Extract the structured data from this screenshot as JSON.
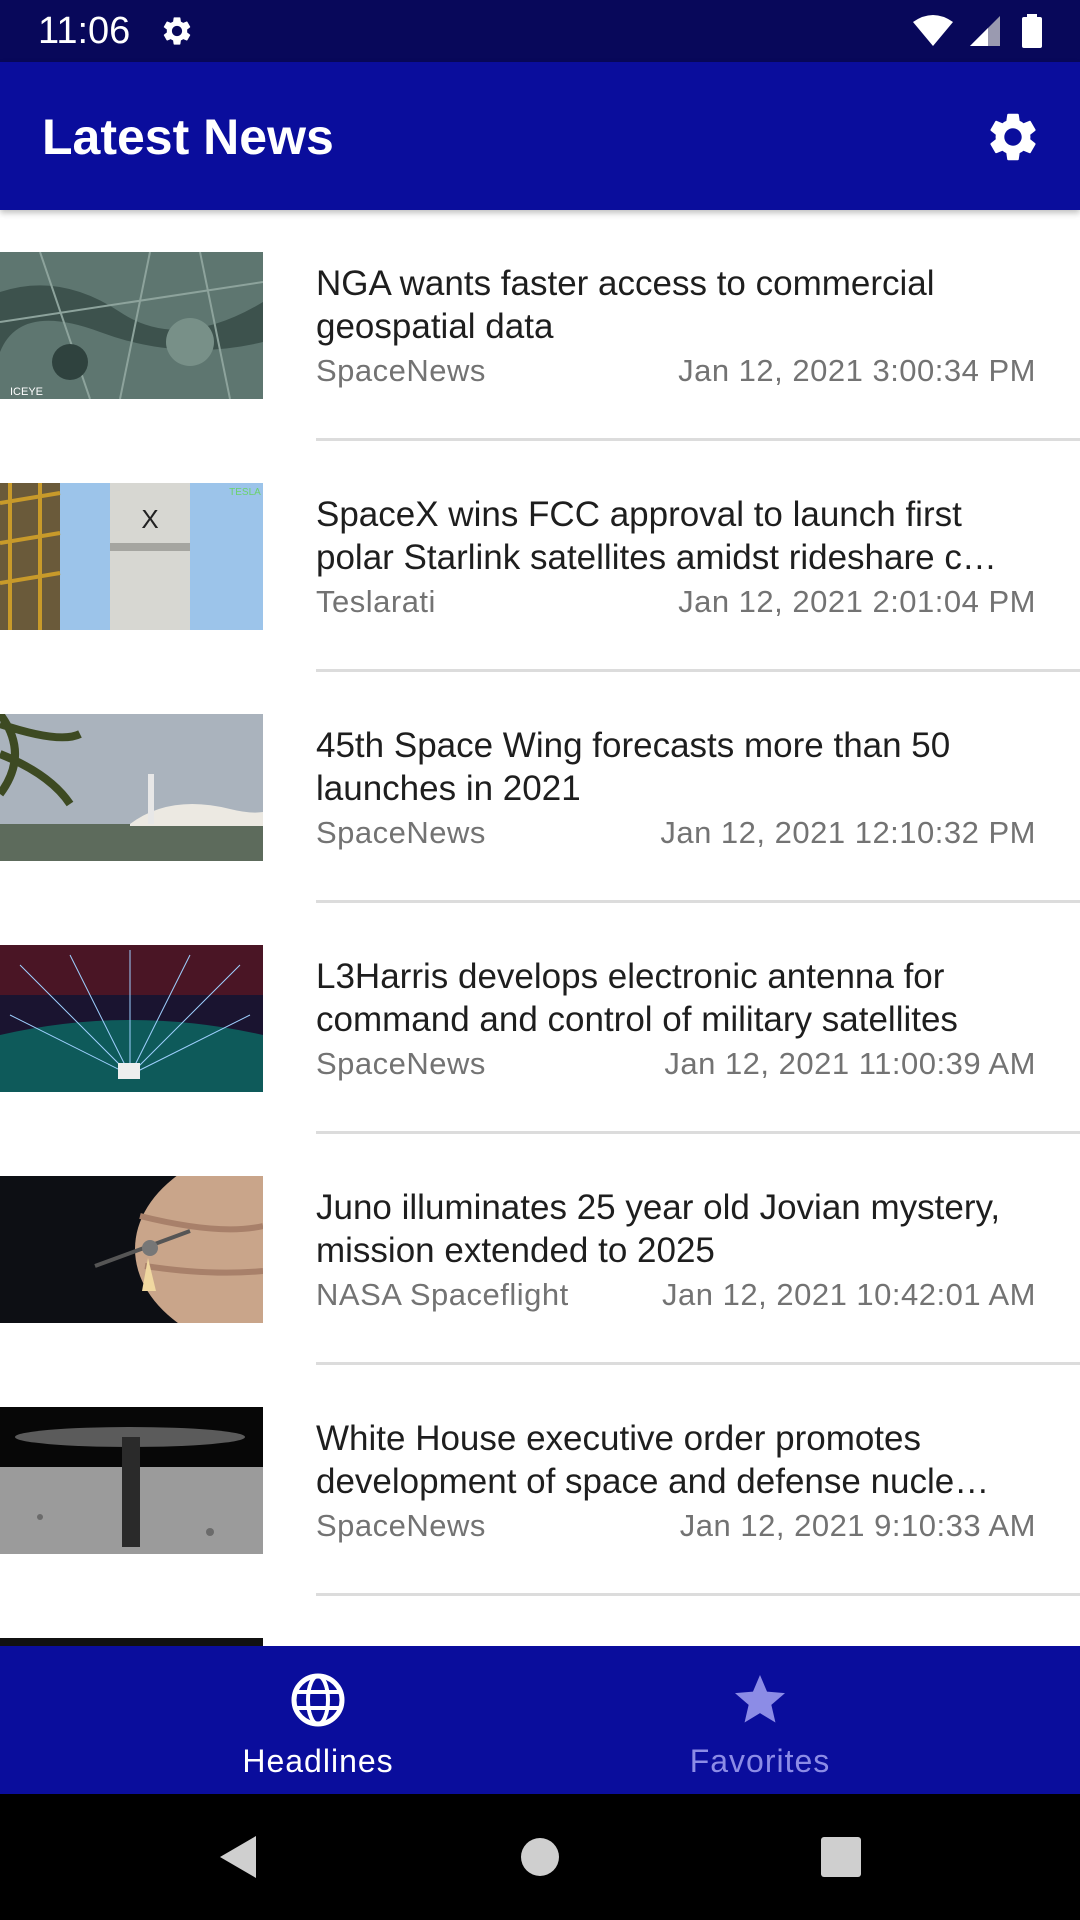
{
  "status_bar": {
    "time": "11:06"
  },
  "app_bar": {
    "title": "Latest News"
  },
  "articles": [
    {
      "title": "NGA wants faster access to commercial geospatial data",
      "source": "SpaceNews",
      "date": "Jan 12, 2021 3:00:34 PM",
      "thumb_logo": "ICEYE"
    },
    {
      "title": "SpaceX wins FCC approval to launch first polar Starlink satellites amidst rideshare c…",
      "source": "Teslarati",
      "date": "Jan 12, 2021 2:01:04 PM",
      "thumb_logo": "TESLA"
    },
    {
      "title": "45th Space Wing forecasts more than 50 launches in 2021",
      "source": "SpaceNews",
      "date": "Jan 12, 2021 12:10:32 PM"
    },
    {
      "title": "L3Harris develops electronic antenna for command and control of military satellites",
      "source": "SpaceNews",
      "date": "Jan 12, 2021 11:00:39 AM"
    },
    {
      "title": "Juno illuminates 25 year old Jovian mystery, mission extended to 2025",
      "source": "NASA Spaceflight",
      "date": "Jan 12, 2021 10:42:01 AM"
    },
    {
      "title": "White House executive order promotes development of space and defense nucle…",
      "source": "SpaceNews",
      "date": "Jan 12, 2021 9:10:33 AM"
    }
  ],
  "bottom_nav": {
    "items": [
      {
        "label": "Headlines",
        "icon": "globe-icon",
        "active": true
      },
      {
        "label": "Favorites",
        "icon": "star-icon",
        "active": false
      }
    ]
  },
  "colors": {
    "status_bar": "#08085a",
    "app_bar": "#0a0d9c",
    "nav_inactive": "#8c8ce6"
  }
}
